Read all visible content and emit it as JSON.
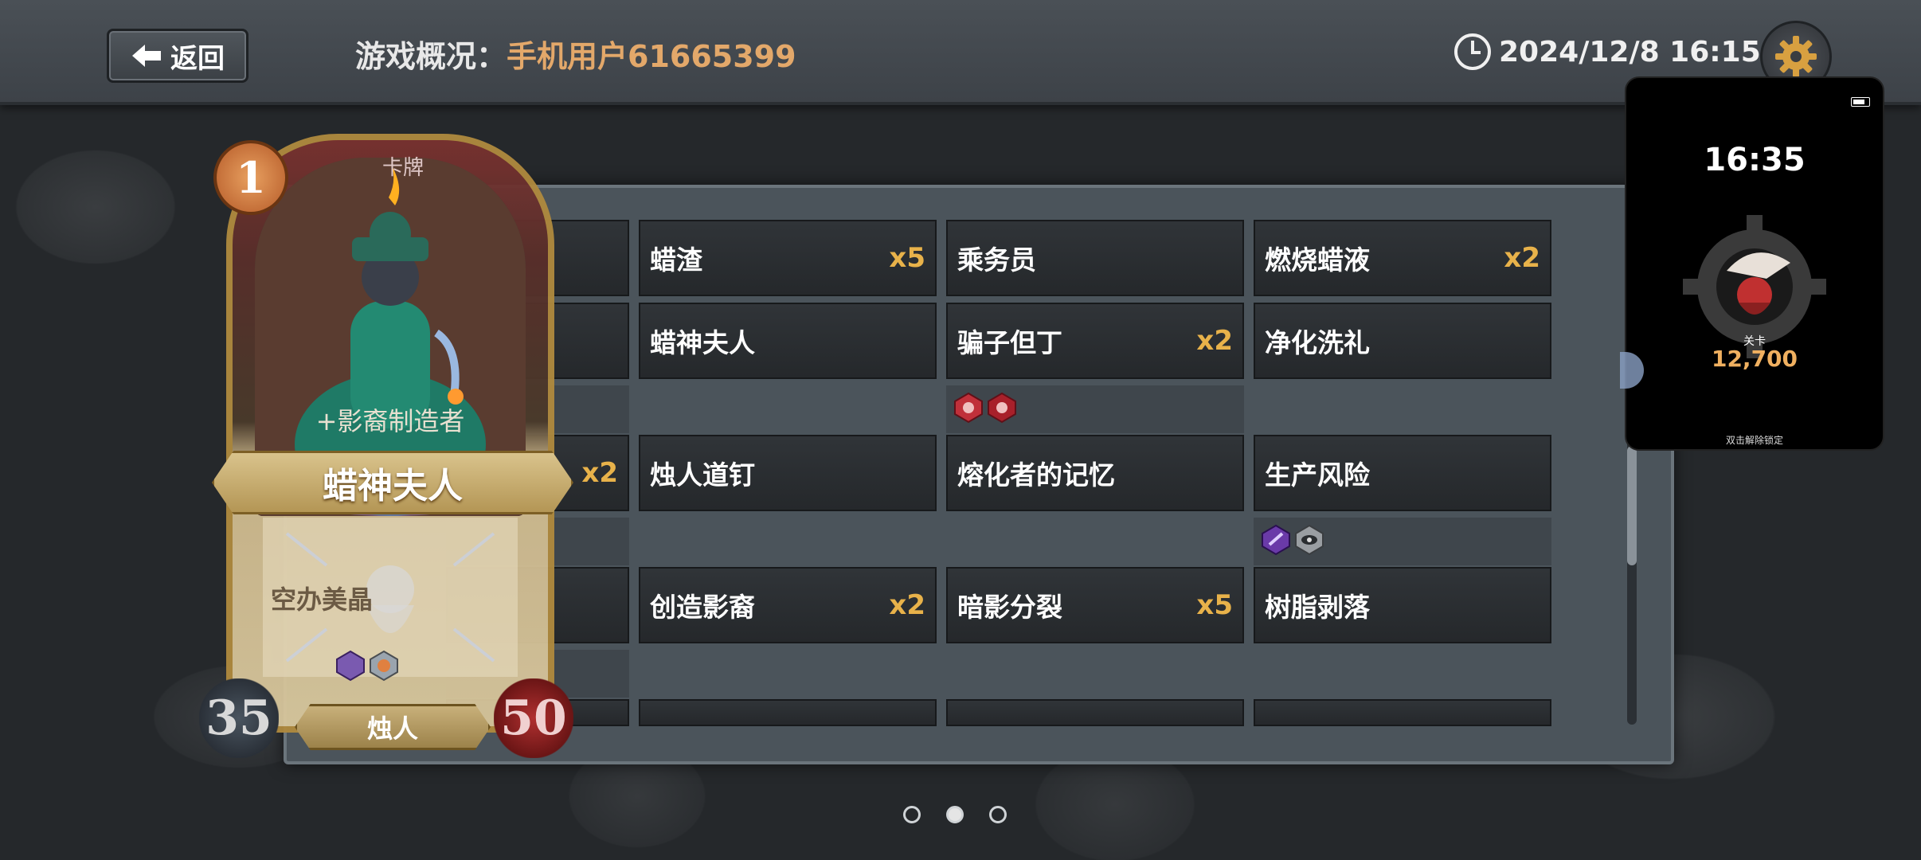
{
  "header": {
    "back_label": "返回",
    "title_label": "游戏概况：",
    "username": "手机用户61665399",
    "datetime": "2024/12/8 16:15"
  },
  "cards": [
    {
      "name": "蜡渣",
      "count": "x5"
    },
    {
      "name": "乘务员",
      "count": ""
    },
    {
      "name": "燃烧蜡液",
      "count": "x2"
    },
    {
      "name": "蜡神夫人",
      "count": ""
    },
    {
      "name": "骗子但丁",
      "count": "x2"
    },
    {
      "name": "净化洗礼",
      "count": ""
    },
    {
      "name": "",
      "count": "x2"
    },
    {
      "name": "烛人道钉",
      "count": ""
    },
    {
      "name": "熔化者的记忆",
      "count": ""
    },
    {
      "name": "生产风险",
      "count": ""
    },
    {
      "name": "创造影裔",
      "count": "x2"
    },
    {
      "name": "暗影分裂",
      "count": "x5"
    },
    {
      "name": "树脂剥落",
      "count": ""
    }
  ],
  "featured_card": {
    "cost": "1",
    "top_label": "卡牌",
    "subtitle": "+影裔制造者",
    "name": "蜡神夫人",
    "description": "空办美晶",
    "attack": "35",
    "health": "50",
    "tribe": "烛人"
  },
  "pagination": {
    "pages": 3,
    "current": 2
  },
  "lock_widget": {
    "time": "16:35",
    "stage_label": "关卡",
    "stage_value": "12,700",
    "hint": "双击解除锁定"
  },
  "colors": {
    "accent_gold": "#e8b24a",
    "username_orange": "#e3a86a",
    "panel_bg": "#4b545b"
  },
  "icons": [
    "back-arrow-icon",
    "clock-icon",
    "gear-icon"
  ]
}
